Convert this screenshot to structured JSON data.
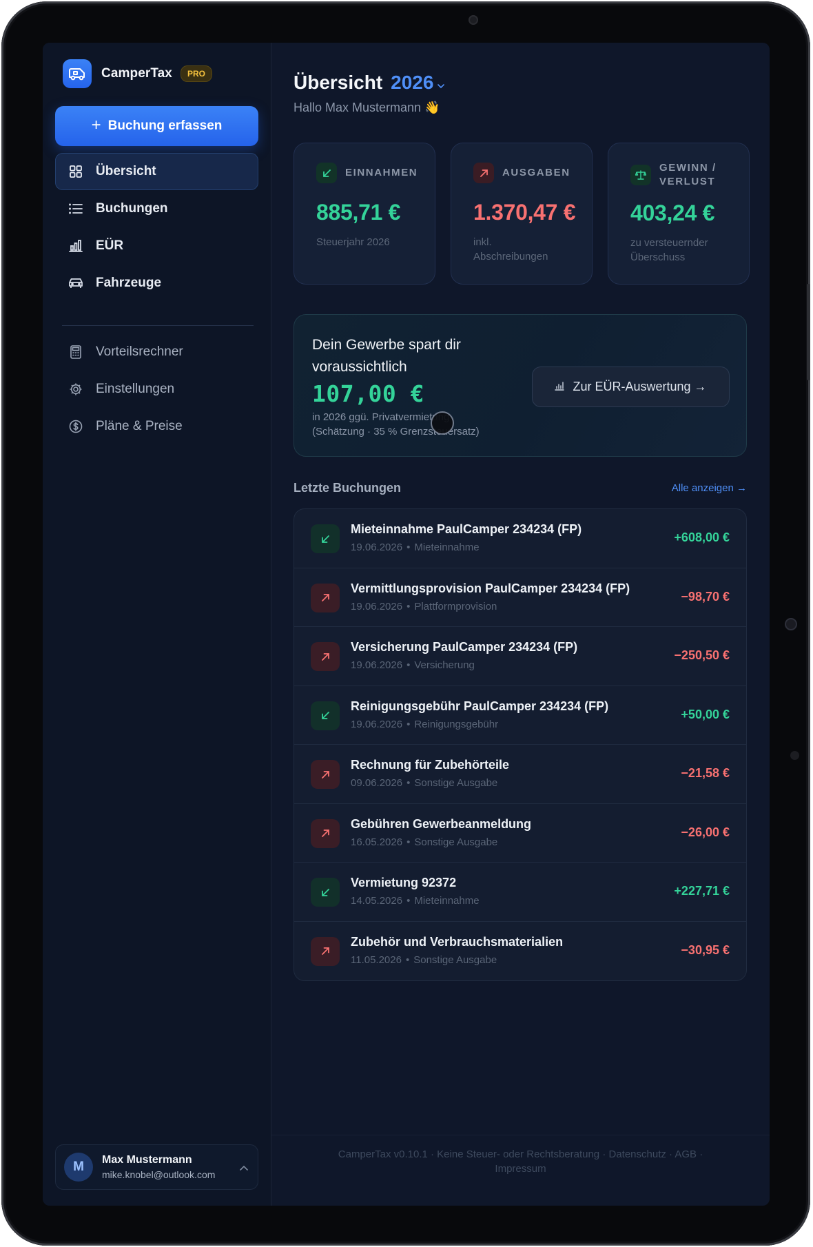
{
  "app": {
    "name": "CamperTax",
    "badge": "PRO"
  },
  "sidebar": {
    "cta_label": "Buchung erfassen",
    "primary_items": [
      {
        "label": "Übersicht",
        "icon": "grid-icon",
        "active": true
      },
      {
        "label": "Buchungen",
        "icon": "list-icon",
        "active": false
      },
      {
        "label": "EÜR",
        "icon": "bar-chart-icon",
        "active": false
      },
      {
        "label": "Fahrzeuge",
        "icon": "car-icon",
        "active": false
      }
    ],
    "secondary_items": [
      {
        "label": "Vorteilsrechner",
        "icon": "calculator-icon"
      },
      {
        "label": "Einstellungen",
        "icon": "gear-icon"
      },
      {
        "label": "Pläne & Preise",
        "icon": "dollar-circle-icon"
      }
    ],
    "user": {
      "initial": "M",
      "name": "Max Mustermann",
      "email": "mike.knobel@outlook.com"
    }
  },
  "header": {
    "title": "Übersicht",
    "year": "2026",
    "greeting": "Hallo Max Mustermann 👋"
  },
  "stats": [
    {
      "label": "EINNAHMEN",
      "value": "885,71 €",
      "sub": "Steuerjahr 2026",
      "tone": "green",
      "icon": "arrow-down-left-icon"
    },
    {
      "label": "AUSGABEN",
      "value": "1.370,47 €",
      "sub": "inkl. Abschreibungen",
      "tone": "red",
      "icon": "arrow-up-right-icon"
    },
    {
      "label": "GEWINN / VERLUST",
      "value": "403,24 €",
      "sub": "zu versteuernder Überschuss",
      "tone": "green",
      "icon": "scale-icon"
    }
  ],
  "savings": {
    "title": "Dein Gewerbe spart dir voraussichtlich",
    "amount": "107,00 €",
    "sub_line1": "in 2026 ggü. Privatvermietung",
    "sub_line2": "(Schätzung · 35 % Grenzsteuersatz)",
    "button_label": "Zur EÜR-Auswertung →"
  },
  "bookings": {
    "title": "Letzte Buchungen",
    "link": "Alle anzeigen →",
    "items": [
      {
        "title": "Mieteinnahme PaulCamper 234234 (FP)",
        "date": "19.06.2026",
        "category": "Mieteinnahme",
        "amount": "+608,00 €",
        "type": "income"
      },
      {
        "title": "Vermittlungsprovision PaulCamper 234234 (FP)",
        "date": "19.06.2026",
        "category": "Plattformprovision",
        "amount": "−98,70 €",
        "type": "expense"
      },
      {
        "title": "Versicherung PaulCamper 234234 (FP)",
        "date": "19.06.2026",
        "category": "Versicherung",
        "amount": "−250,50 €",
        "type": "expense"
      },
      {
        "title": "Reinigungsgebühr PaulCamper 234234 (FP)",
        "date": "19.06.2026",
        "category": "Reinigungsgebühr",
        "amount": "+50,00 €",
        "type": "income"
      },
      {
        "title": "Rechnung für Zubehörteile",
        "date": "09.06.2026",
        "category": "Sonstige Ausgabe",
        "amount": "−21,58 €",
        "type": "expense"
      },
      {
        "title": "Gebühren Gewerbeanmeldung",
        "date": "16.05.2026",
        "category": "Sonstige Ausgabe",
        "amount": "−26,00 €",
        "type": "expense"
      },
      {
        "title": "Vermietung 92372",
        "date": "14.05.2026",
        "category": "Mieteinnahme",
        "amount": "+227,71 €",
        "type": "income"
      },
      {
        "title": "Zubehör und Verbrauchsmaterialien",
        "date": "11.05.2026",
        "category": "Sonstige Ausgabe",
        "amount": "−30,95 €",
        "type": "expense"
      }
    ]
  },
  "footer": {
    "line1": "CamperTax v0.10.1 · Keine Steuer- oder Rechtsberatung · Datenschutz · AGB ·",
    "line2": "Impressum"
  },
  "colors": {
    "accent": "#3b82f6",
    "income": "#34d399",
    "expense": "#f87171",
    "background": "#0f172a"
  }
}
